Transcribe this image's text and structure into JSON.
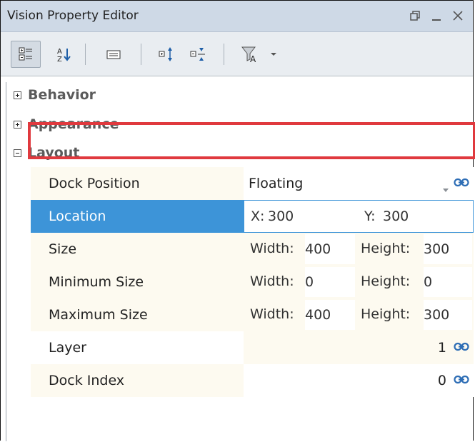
{
  "window": {
    "title": "Vision Property Editor",
    "controls": [
      "restore-icon",
      "minimize-icon",
      "close-icon"
    ]
  },
  "toolbar": {
    "buttons": [
      "categorized-view-icon",
      "sort-alphabetical-icon",
      "show-descriptions-icon",
      "expand-all-icon",
      "collapse-all-icon",
      "filter-icon",
      "dropdown-arrow-icon"
    ]
  },
  "categories": {
    "behavior": "Behavior",
    "appearance": "Appearance",
    "layout": "Layout"
  },
  "properties": {
    "dock_position": {
      "name": "Dock Position",
      "value": "Floating"
    },
    "location": {
      "name": "Location",
      "x_label": "X:",
      "x_value": "300",
      "y_label": "Y:",
      "y_value": "300"
    },
    "size": {
      "name": "Size",
      "w_label": "Width:",
      "w_value": "400",
      "h_label": "Height:",
      "h_value": "300"
    },
    "minimum_size": {
      "name": "Minimum Size",
      "w_label": "Width:",
      "w_value": "0",
      "h_label": "Height:",
      "h_value": "0"
    },
    "maximum_size": {
      "name": "Maximum Size",
      "w_label": "Width:",
      "w_value": "400",
      "h_label": "Height:",
      "h_value": "300"
    },
    "layer": {
      "name": "Layer",
      "value": "1"
    },
    "dock_index": {
      "name": "Dock Index",
      "value": "0"
    }
  },
  "colors": {
    "selection": "#3d94d8",
    "highlight_border": "#e0393e",
    "title_bar": "#ced9e6"
  }
}
